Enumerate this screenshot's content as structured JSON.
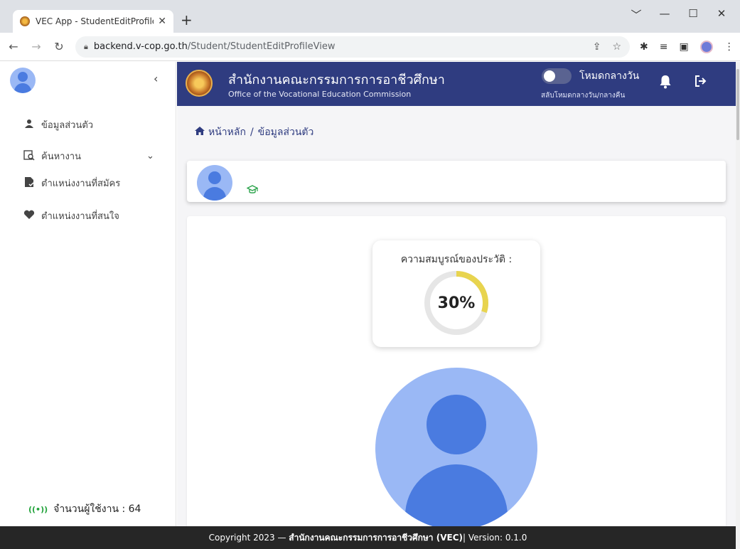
{
  "browser": {
    "tab_title": "VEC App - StudentEditProfileVie",
    "tab_close": "✕",
    "new_tab": "+",
    "url_host": "backend.v-cop.go.th",
    "url_path": "/Student/StudentEditProfileView",
    "window_controls": [
      "﹀",
      "—",
      "☐",
      "✕"
    ]
  },
  "sidebar": {
    "collapse_symbol": "‹",
    "items": [
      {
        "label": "ข้อมูลส่วนตัว",
        "icon": "person-icon"
      },
      {
        "label": "ค้นหางาน",
        "icon": "search-job-icon"
      },
      {
        "label": "ตำแหน่งงานที่สมัคร",
        "icon": "applied-job-icon"
      },
      {
        "label": "ตำแหน่งงานที่สนใจ",
        "icon": "heart-icon"
      }
    ],
    "online_users_label": "จำนวนผู้ใช้งาน : 64",
    "online_signal": "((•))"
  },
  "header": {
    "org_name_th": "สำนักงานคณะกรรมการการอาชีวศึกษา",
    "org_name_en": "Office of the Vocational Education Commission",
    "mode_label": "โหมดกลางวัน",
    "mode_sub": "สลับโหมดกลางวัน/กลางคืน",
    "theme_color": "#2f3c80"
  },
  "breadcrumb": {
    "home": "หน้าหลัก",
    "separator": "/",
    "current": "ข้อมูลส่วนตัว"
  },
  "profile": {
    "completeness_label": "ความสมบูรณ์ของประวัติ :",
    "completeness_text": "30%",
    "completeness_value": 30
  },
  "footer": {
    "prefix": "Copyright 2023 — ",
    "org": "สำนักงานคณะกรรมการการอาชีวศึกษา (VEC)",
    "suffix": " | Version: 0.1.0"
  }
}
